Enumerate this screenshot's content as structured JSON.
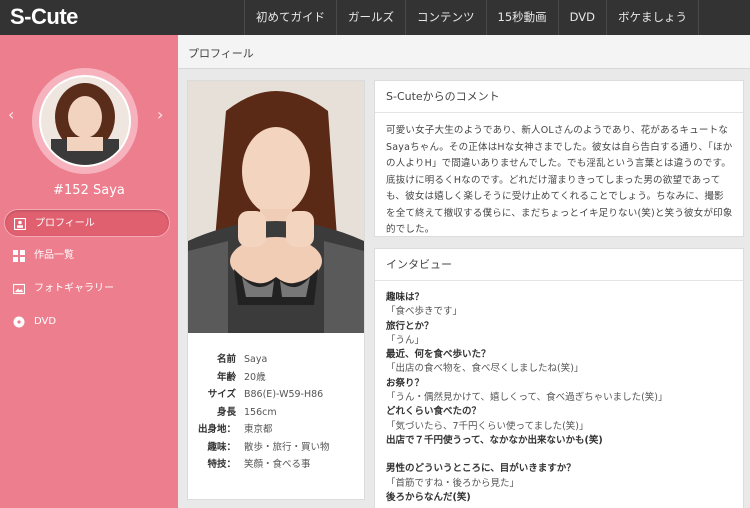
{
  "logo": "S-Cute",
  "nav": [
    "初めてガイド",
    "ガールズ",
    "コンテンツ",
    "15秒動画",
    "DVD",
    "ボケましょう"
  ],
  "sidebar": {
    "prev_arrow": "‹",
    "next_arrow": "›",
    "model_name": "#152 Saya",
    "menu": [
      {
        "label": "プロフィール",
        "icon": "profile-icon",
        "active": true
      },
      {
        "label": "作品一覧",
        "icon": "grid-icon",
        "active": false
      },
      {
        "label": "フォトギャラリー",
        "icon": "photo-icon",
        "active": false
      },
      {
        "label": "DVD",
        "icon": "disc-icon",
        "active": false
      }
    ]
  },
  "main": {
    "header": "プロフィール",
    "specs": [
      {
        "label": "名前",
        "value": "Saya"
      },
      {
        "label": "年齢",
        "value": "20歳"
      },
      {
        "label": "サイズ",
        "value": "B86(E)-W59-H86"
      },
      {
        "label": "身長",
        "value": "156cm"
      },
      {
        "label": "出身地：",
        "value": "東京都"
      },
      {
        "label": "趣味：",
        "value": "散歩・旅行・買い物"
      },
      {
        "label": "特技：",
        "value": "笑顔・食べる事"
      }
    ],
    "comment_title": "S-Cuteからのコメント",
    "comment_text": "可愛い女子大生のようであり、新人OLさんのようであり、花があるキュートなSayaちゃん。その正体はHな女神さまでした。彼女は自ら告白する通り、「ほかの人よりH」で間違いありませんでした。でも淫乱という言葉とは違うのです。底抜けに明るくHなのです。どれだけ溜まりきってしまった男の欲望であっても、彼女は嬉しく楽しそうに受け止めてくれることでしょう。ちなみに、撮影を全て終えて撤収する僕らに、まだちょっとイキ足りない(笑)と笑う彼女が印象的でした。",
    "interview_title": "インタビュー",
    "interview": [
      {
        "q": "趣味は？",
        "a": "「食べ歩きです」"
      },
      {
        "q": "旅行とか？",
        "a": "「うん」"
      },
      {
        "q": "最近、何を食べ歩いた？",
        "a": "「出店の食べ物を、食べ尽くしましたね(笑)」"
      },
      {
        "q": "お祭り？",
        "a": "「うん・偶然見かけて、嬉しくって、食べ過ぎちゃいました(笑)」"
      },
      {
        "q": "どれくらい食べたの？",
        "a": "「気づいたら、7千円くらい使ってました(笑)」"
      },
      {
        "q": "出店で７千円使うって、なかなか出来ないかも(笑)",
        "a": ""
      },
      {
        "q": "男性のどういうところに、目がいきますか？",
        "a": "「首筋ですね・後ろから見た」"
      },
      {
        "q": "後ろからなんだ(笑)",
        "a": ""
      }
    ]
  },
  "colors": {
    "sidebar": "#ed7e8d",
    "topbar": "#333333",
    "active_menu": "#e06070"
  }
}
